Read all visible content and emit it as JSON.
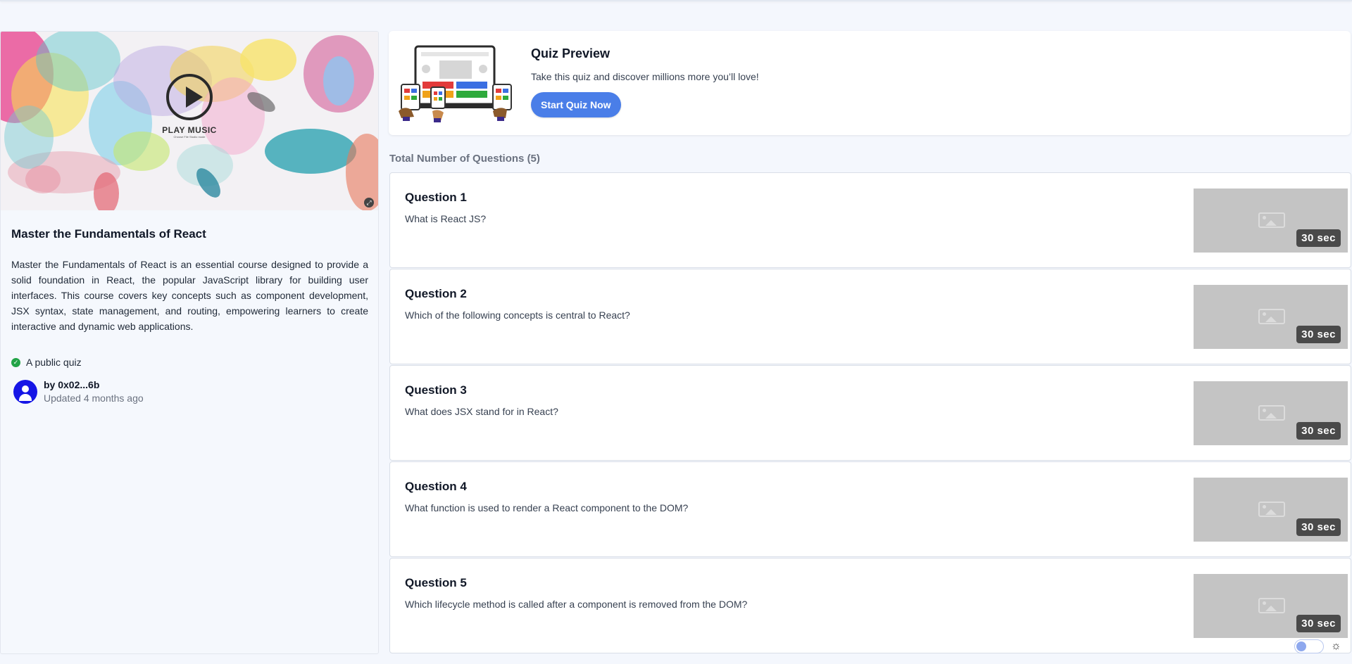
{
  "cover": {
    "play_label": "PLAY MUSIC",
    "play_sub": "Choose File    Studio mode",
    "corner_icon": "expand-icon"
  },
  "course": {
    "title": "Master the Fundamentals of React",
    "description": "Master the Fundamentals of React is an essential course designed to provide a solid foundation in React, the popular JavaScript library for building user interfaces. This course covers key concepts such as component development, JSX syntax, state management, and routing, empowering learners to create interactive and dynamic web applications.",
    "visibility": "A public quiz",
    "author": "by 0x02...6b",
    "updated": "Updated 4 months ago"
  },
  "preview": {
    "title": "Quiz Preview",
    "subtitle": "Take this quiz and discover millions more you’ll love!",
    "start_button": "Start Quiz Now"
  },
  "questions_header": "Total Number of Questions (5)",
  "questions": [
    {
      "title": "Question 1",
      "text": "What is React JS?",
      "time": "30 sec"
    },
    {
      "title": "Question 2",
      "text": "Which of the following concepts is central to React?",
      "time": "30 sec"
    },
    {
      "title": "Question 3",
      "text": "What does JSX stand for in React?",
      "time": "30 sec"
    },
    {
      "title": "Question 4",
      "text": "What function is used to render a React component to the DOM?",
      "time": "30 sec"
    },
    {
      "title": "Question 5",
      "text": "Which lifecycle method is called after a component is removed from the DOM?",
      "time": "30 sec"
    }
  ],
  "colors": {
    "accent": "#4a7ee8",
    "avatar": "#1616e6",
    "public_check": "#22a447"
  }
}
